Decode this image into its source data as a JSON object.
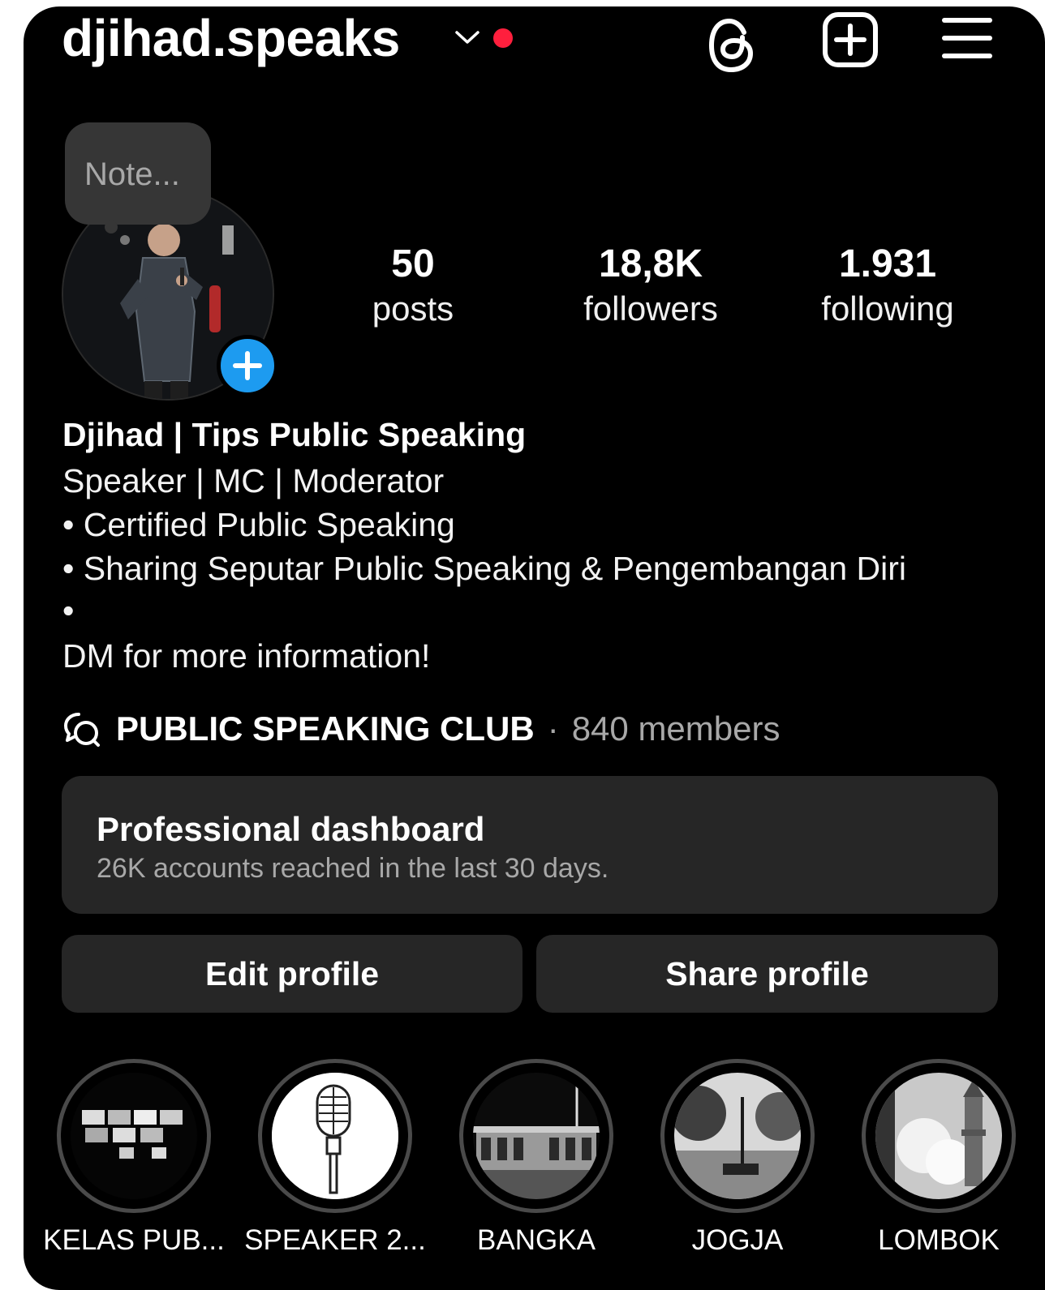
{
  "header": {
    "username": "djihad.speaks",
    "icons": [
      "chevron-down-icon",
      "threads-icon",
      "create-post-icon",
      "menu-icon"
    ],
    "notification_color": "#ff1f3d"
  },
  "note": {
    "placeholder": "Note..."
  },
  "stats": [
    {
      "value": "50",
      "label": "posts"
    },
    {
      "value": "18,8K",
      "label": "followers"
    },
    {
      "value": "1.931",
      "label": "following"
    }
  ],
  "bio": {
    "name": "Djihad | Tips Public Speaking",
    "lines": [
      "Speaker | MC | Moderator",
      "• Certified Public Speaking",
      "• Sharing Seputar Public Speaking & Pengembangan Diri",
      "•",
      "DM for more information!"
    ]
  },
  "channel": {
    "name": "PUBLIC SPEAKING CLUB",
    "separator": "·",
    "members": "840 members"
  },
  "dashboard": {
    "title": "Professional dashboard",
    "subtitle": "26K accounts reached in the last 30 days."
  },
  "buttons": {
    "edit": "Edit profile",
    "share": "Share profile"
  },
  "highlights": [
    {
      "label": "KELAS PUB..."
    },
    {
      "label": "SPEAKER 2..."
    },
    {
      "label": "BANGKA"
    },
    {
      "label": "JOGJA"
    },
    {
      "label": "LOMBOK"
    }
  ],
  "colors": {
    "background": "#000000",
    "card": "#262626",
    "accent_blue": "#1d9bf0",
    "muted_text": "#a8a8a8"
  }
}
